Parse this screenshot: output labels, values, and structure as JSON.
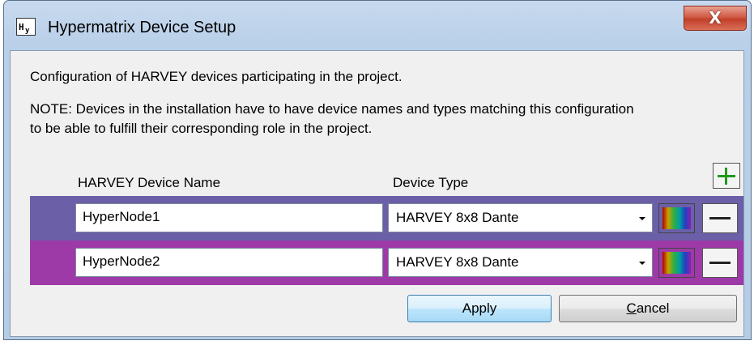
{
  "window": {
    "title": "Hypermatrix Device Setup",
    "app_icon_text": "Hₗ",
    "close_glyph": "X"
  },
  "content": {
    "intro": "Configuration of HARVEY devices participating in the project.",
    "note_line1": "NOTE: Devices in the installation have to have device names and types matching this configuration",
    "note_line2": "to be able to fulfill their corresponding role in the project."
  },
  "table": {
    "name_header": "HARVEY Device Name",
    "type_header": "Device Type",
    "rows": [
      {
        "name": "HyperNode1",
        "type": "HARVEY 8x8 Dante",
        "color": "#6b5fa8"
      },
      {
        "name": "HyperNode2",
        "type": "HARVEY 8x8 Dante",
        "color": "#9e3aa8"
      }
    ]
  },
  "buttons": {
    "apply": "Apply",
    "cancel": "Cancel"
  },
  "icons": {
    "add": "plus-icon",
    "remove": "minus-icon",
    "color_picker": "color-spectrum-icon",
    "dropdown": "chevron-down-icon"
  }
}
